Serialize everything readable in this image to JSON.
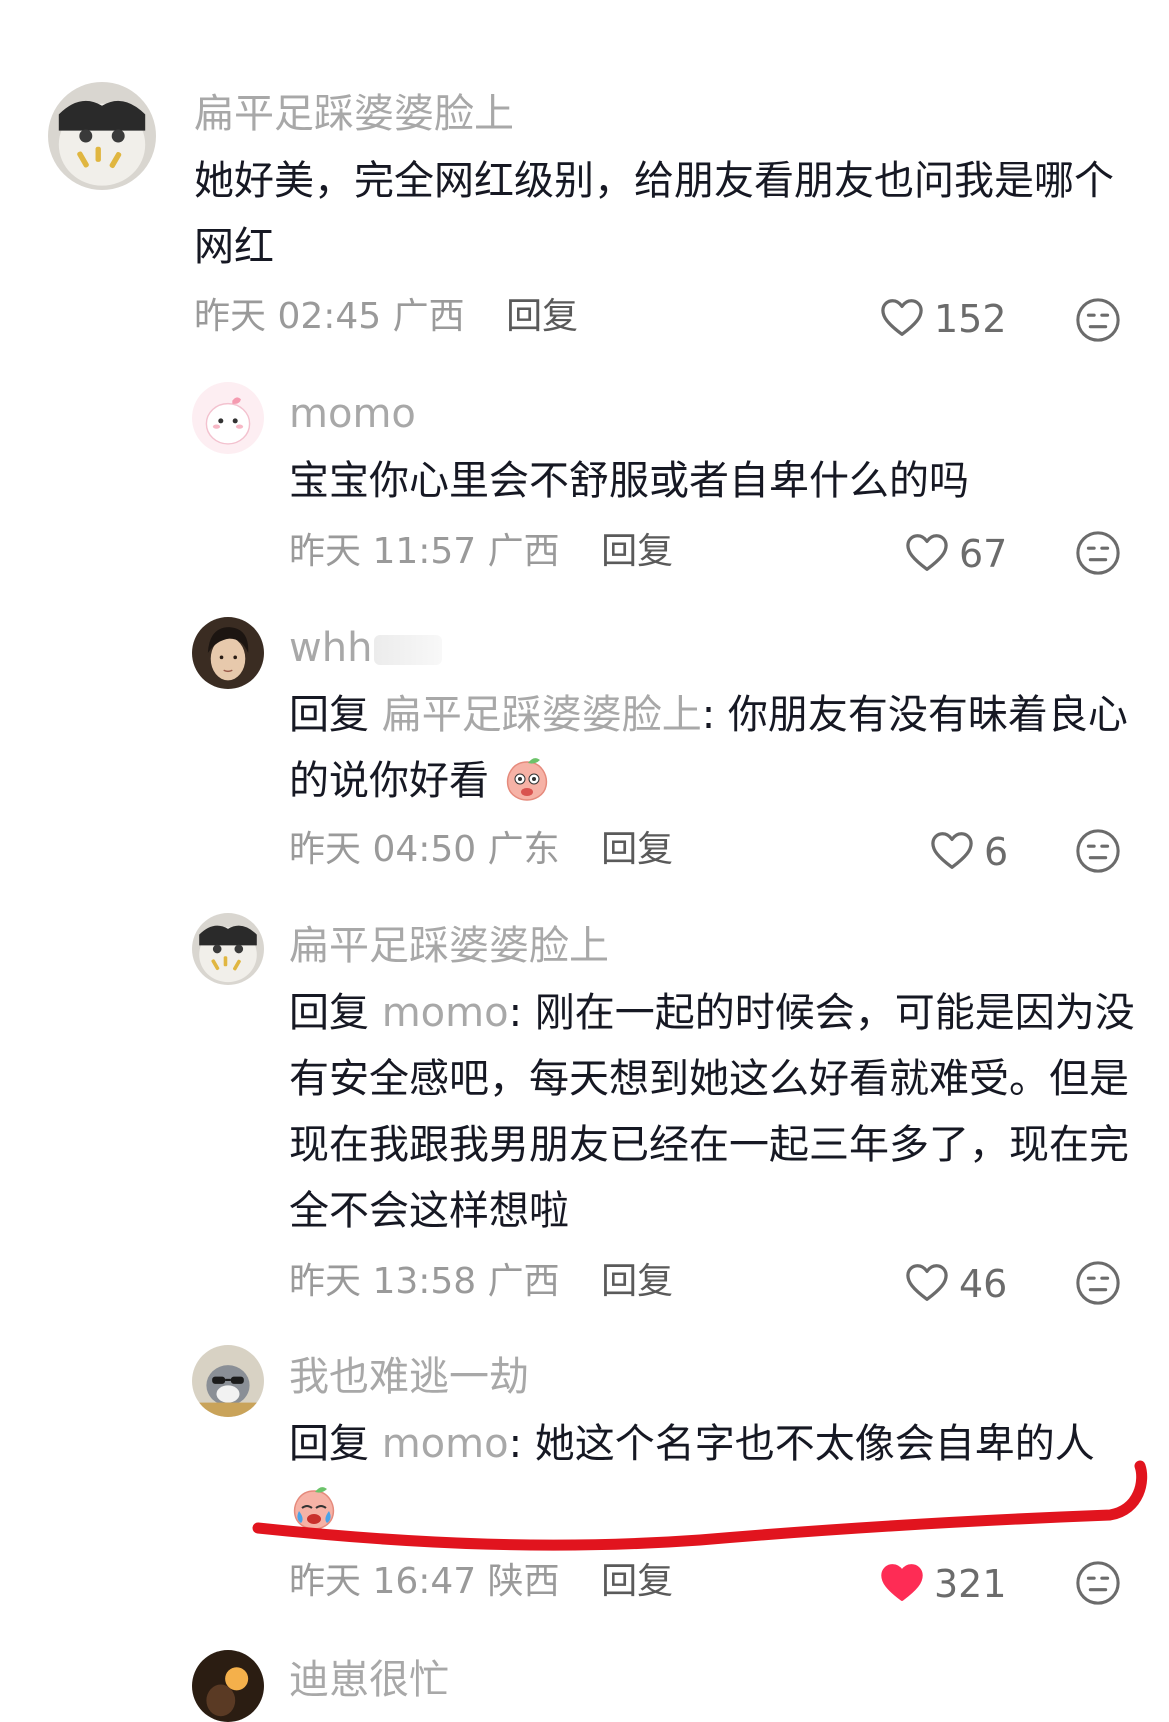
{
  "colors": {
    "accent_like": "#fe2c55",
    "muted": "#a8a8a8",
    "text": "#161823",
    "annotation": "#e1141e"
  },
  "comments": [
    {
      "username": "扁平足踩婆婆脸上",
      "text": "她好美，完全网红级别，给朋友看朋友也问我是哪个网红",
      "time": "昨天 02:45",
      "region": "广西",
      "reply_label": "回复",
      "likes": "152",
      "avatar_icon": "cat-avatar",
      "liked": false
    },
    {
      "username": "momo",
      "text": "宝宝你心里会不舒服或者自卑什么的吗",
      "time": "昨天 11:57",
      "region": "广西",
      "reply_label": "回复",
      "likes": "67",
      "avatar_icon": "cartoon-avatar",
      "liked": false
    },
    {
      "username": "whh",
      "reply_prefix": "回复",
      "reply_to": "扁平足踩婆婆脸上",
      "text": "你朋友有没有昧着良心的说你好看",
      "emoji": "peach-emoji",
      "time": "昨天 04:50",
      "region": "广东",
      "reply_label": "回复",
      "likes": "6",
      "avatar_icon": "man-avatar",
      "liked": false
    },
    {
      "username": "扁平足踩婆婆脸上",
      "reply_prefix": "回复",
      "reply_to": "momo",
      "text": "刚在一起的时候会，可能是因为没有安全感吧，每天想到她这么好看就难受。但是现在我跟我男朋友已经在一起三年多了，现在完全不会这样想啦",
      "time": "昨天 13:58",
      "region": "广西",
      "reply_label": "回复",
      "likes": "46",
      "avatar_icon": "cat-avatar",
      "liked": false
    },
    {
      "username": "我也难逃一劫",
      "reply_prefix": "回复",
      "reply_to": "momo",
      "text": "她这个名字也不太像会自卑的人",
      "emoji": "crying-emoji",
      "time": "昨天 16:47",
      "region": "陕西",
      "reply_label": "回复",
      "likes": "321",
      "avatar_icon": "dog-sunglasses-avatar",
      "liked": true
    },
    {
      "username": "迪崽很忙",
      "avatar_icon": "dark-avatar"
    }
  ]
}
